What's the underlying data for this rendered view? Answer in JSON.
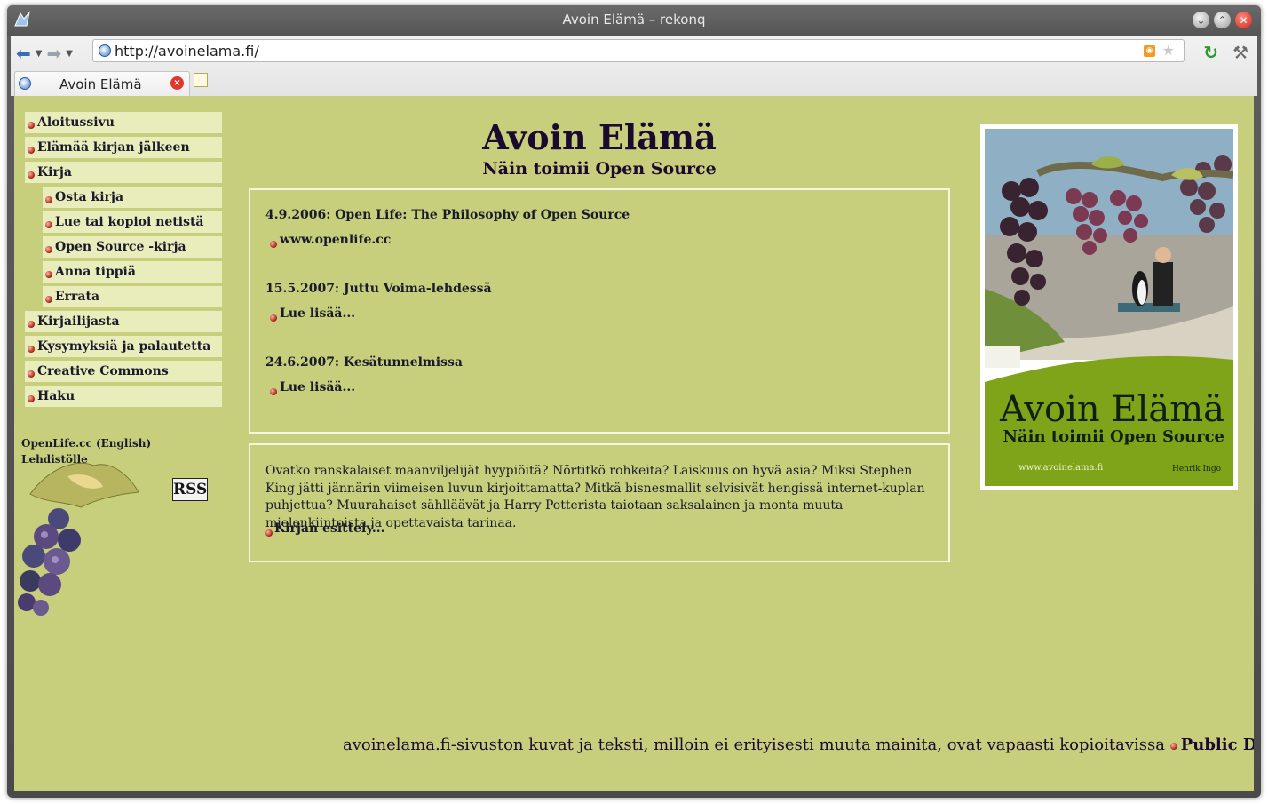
{
  "window": {
    "title": "Avoin Elämä – rekonq"
  },
  "toolbar": {
    "url": "http://avoinelama.fi/"
  },
  "tabs": [
    {
      "label": "Avoin Elämä"
    }
  ],
  "page": {
    "heading": "Avoin Elämä",
    "subheading": "Näin toimii Open Source",
    "nav": [
      {
        "label": "Aloitussivu",
        "level": 0
      },
      {
        "label": "Elämää kirjan jälkeen",
        "level": 0
      },
      {
        "label": "Kirja",
        "level": 0
      },
      {
        "label": "Osta kirja",
        "level": 1
      },
      {
        "label": "Lue tai kopioi netistä",
        "level": 1
      },
      {
        "label": "Open Source -kirja",
        "level": 1
      },
      {
        "label": "Anna tippiä",
        "level": 1
      },
      {
        "label": "Errata",
        "level": 1
      },
      {
        "label": "Kirjailijasta",
        "level": 0
      },
      {
        "label": "Kysymyksiä ja palautetta",
        "level": 0
      },
      {
        "label": "Creative Commons",
        "level": 0
      },
      {
        "label": "Haku",
        "level": 0
      }
    ],
    "side_links": {
      "openlife": "OpenLife.cc (English)",
      "press": "Lehdistölle"
    },
    "rss_label": "RSS",
    "news": [
      {
        "title": "4.9.2006: Open Life: The Philosophy of Open Source",
        "link": "www.openlife.cc"
      },
      {
        "title": "15.5.2007: Juttu Voima-lehdessä",
        "link": "Lue lisää..."
      },
      {
        "title": "24.6.2007: Kesätunnelmissa",
        "link": "Lue lisää..."
      }
    ],
    "intro": {
      "text": "Ovatko ranskalaiset maanviljelijät hyypiöitä? Nörtitkö rohkeita? Laiskuus on hyvä asia? Miksi Stephen King jätti jännärin viimeisen luvun kirjoittamatta? Mitkä bisnesmallit selvisivät hengissä internet-kuplan puhjettua? Muurahaiset sählläävät ja Harry Potterista taiotaan saksalainen ja monta muuta mielenkiintoista ja opettavaista tarinaa.",
      "more": "Kirjan esittely..."
    },
    "cover": {
      "title": "Avoin Elämä",
      "subtitle": "Näin toimii Open Source",
      "url": "www.avoinelama.fi",
      "author": "Henrik Ingo"
    },
    "footer": {
      "text": "avoinelama.fi-sivuston kuvat ja teksti, milloin ei erityisesti muuta mainita, ovat vapaasti kopioitavissa",
      "link": "Public Domain -ehdoin",
      "end": "."
    }
  },
  "colors": {
    "page_bg": "#c7cf7c",
    "nav_bg": "#e9ecbb",
    "text": "#1a0a2e",
    "cover_green": "#7fa319"
  },
  "icons": [
    "back-icon",
    "forward-icon",
    "site-icon",
    "rss-feed-icon",
    "bookmark-star-icon",
    "reload-icon",
    "tools-icon",
    "tab-close-icon",
    "new-tab-icon"
  ]
}
